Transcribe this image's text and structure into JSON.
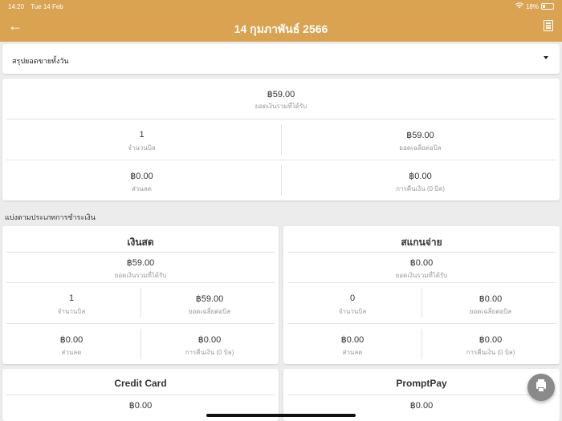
{
  "status": {
    "time": "14:20",
    "date": "Tue 14 Feb",
    "battery": "18%"
  },
  "header": {
    "title": "14 กุมภาพันธ์ 2566"
  },
  "filter": {
    "selected": "สรุปยอดขายทั้งวัน"
  },
  "summary": {
    "total": {
      "value": "฿59.00",
      "label": "ยอดเงินรวมที่ได้รับ"
    },
    "bills": {
      "value": "1",
      "label": "จำนวนบิล"
    },
    "average": {
      "value": "฿59.00",
      "label": "ยอดเฉลี่ยต่อบิล"
    },
    "discount": {
      "value": "฿0.00",
      "label": "ส่วนลด"
    },
    "refund": {
      "value": "฿0.00",
      "label": "การคืนเงิน (0 บิล)"
    }
  },
  "section_label": "แบ่งตามประเภทการชำระเงิน",
  "payments": [
    {
      "name": "เงินสด",
      "total": {
        "value": "฿59.00",
        "label": "ยอดเงินรวมที่ได้รับ"
      },
      "bills": {
        "value": "1",
        "label": "จำนวนบิล"
      },
      "average": {
        "value": "฿59.00",
        "label": "ยอดเฉลี่ยต่อบิล"
      },
      "discount": {
        "value": "฿0.00",
        "label": "ส่วนลด"
      },
      "refund": {
        "value": "฿0.00",
        "label": "การคืนเงิน (0 บิล)"
      }
    },
    {
      "name": "สแกนจ่าย",
      "total": {
        "value": "฿0.00",
        "label": "ยอดเงินรวมที่ได้รับ"
      },
      "bills": {
        "value": "0",
        "label": "จำนวนบิล"
      },
      "average": {
        "value": "฿0.00",
        "label": "ยอดเฉลี่ยต่อบิล"
      },
      "discount": {
        "value": "฿0.00",
        "label": "ส่วนลด"
      },
      "refund": {
        "value": "฿0.00",
        "label": "การคืนเงิน (0 บิล)"
      }
    },
    {
      "name": "Credit Card",
      "total": {
        "value": "฿0.00"
      }
    },
    {
      "name": "PromptPay",
      "total": {
        "value": "฿0.00"
      }
    }
  ],
  "colors": {
    "accent": "#d9a352",
    "background": "#ececec",
    "fab": "#8a8a8a"
  },
  "icons": {
    "back": "arrow-left-icon",
    "report": "receipt-icon",
    "print": "printer-icon"
  }
}
